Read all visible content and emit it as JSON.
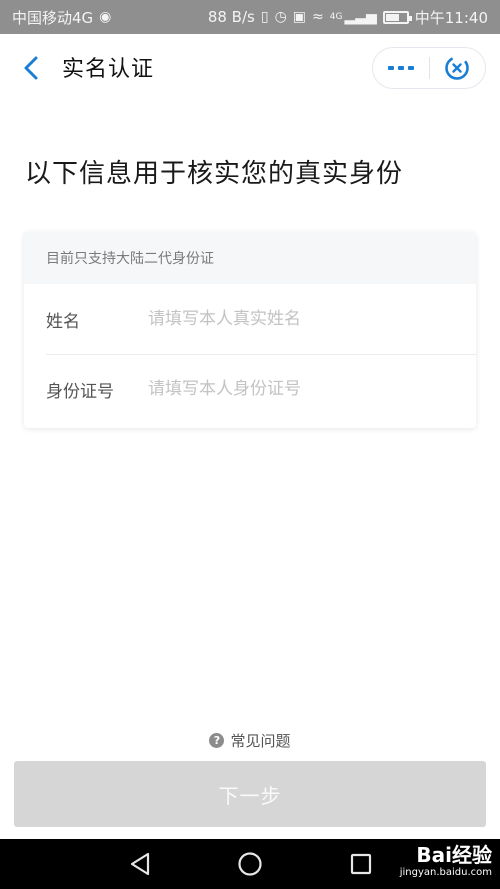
{
  "status_bar": {
    "carrier": "中国移动4G",
    "speed": "88 B/s",
    "net_badge": "4G",
    "time": "中午11:40"
  },
  "header": {
    "title": "实名认证"
  },
  "heading": "以下信息用于核实您的真实身份",
  "card": {
    "notice": "目前只支持大陆二代身份证",
    "name_label": "姓名",
    "name_placeholder": "请填写本人真实姓名",
    "id_label": "身份证号",
    "id_placeholder": "请填写本人身份证号"
  },
  "faq_label": "常见问题",
  "next_label": "下一步",
  "watermark": {
    "main": "Bai经验",
    "sub": "jingyan.baidu.com"
  },
  "colors": {
    "accent": "#1a7fd4",
    "button_disabled": "#d6d6d6"
  }
}
